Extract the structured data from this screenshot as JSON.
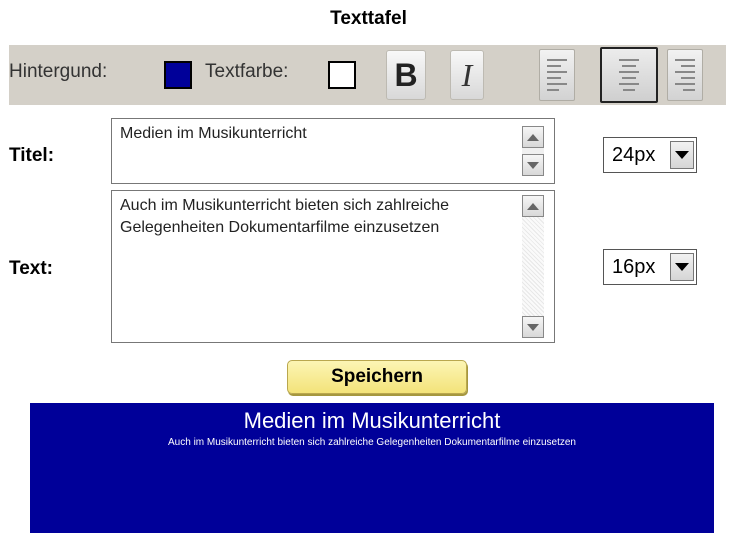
{
  "title": "Texttafel",
  "toolbar": {
    "background_label": "Hintergund:",
    "background_color": "#000099",
    "textcolor_label": "Textfarbe:",
    "text_color": "#ffffff",
    "bold_label": "B",
    "italic_label": "I",
    "align_active": "center",
    "icons": [
      "bold-icon",
      "italic-icon",
      "align-left-icon",
      "align-center-icon",
      "align-right-icon"
    ]
  },
  "form": {
    "title_label": "Titel:",
    "title_value": "Medien im Musikunterricht",
    "title_size": "24px",
    "text_label": "Text:",
    "text_value": "Auch im Musikunterricht bieten sich zahlreiche Gelegenheiten Dokumentarfilme einzusetzen",
    "text_size": "16px",
    "save_label": "Speichern"
  },
  "preview": {
    "title": "Medien im Musikunterricht",
    "text": "Auch im Musikunterricht bieten sich zahlreiche Gelegenheiten Dokumentarfilme einzusetzen",
    "background": "#000099",
    "color": "#ffffff"
  }
}
